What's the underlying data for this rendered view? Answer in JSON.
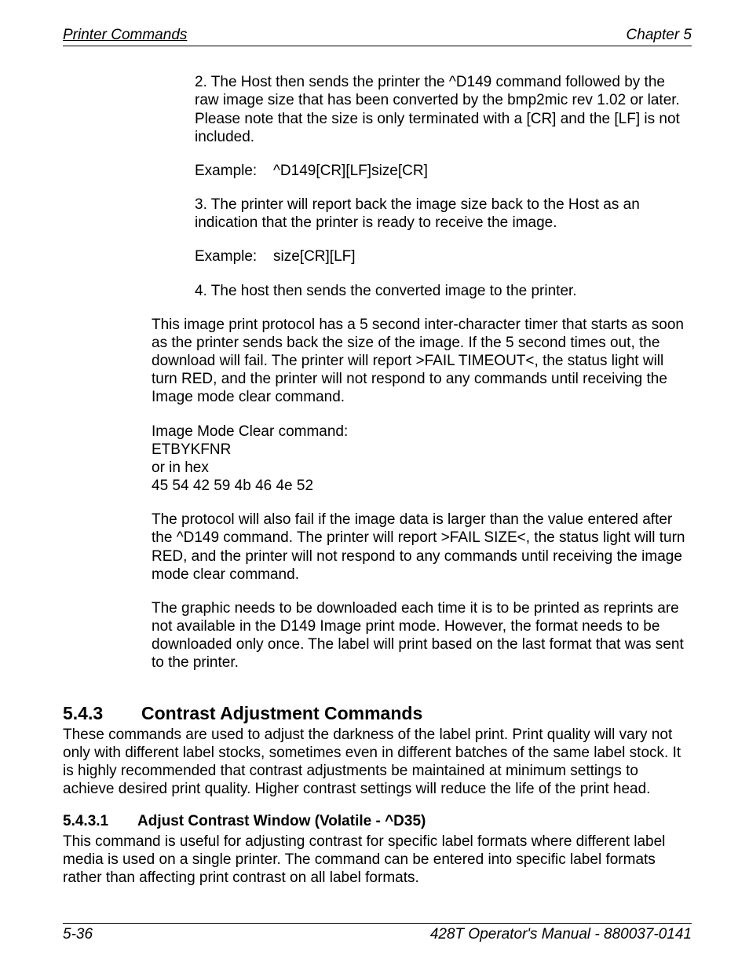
{
  "header": {
    "left": "Printer Commands",
    "right": "Chapter 5"
  },
  "body": {
    "p1": "2. The Host then sends the printer the ^D149 command followed by the raw image size that has been converted by the bmp2mic rev 1.02 or later.  Please note that the size is only terminated with a [CR] and the [LF] is not included.",
    "ex1_label": "Example:",
    "ex1_value": "^D149[CR][LF]size[CR]",
    "p2": "3. The printer will report back the image size back to the Host as an indication that the printer is ready to receive the image.",
    "ex2_label": "Example:",
    "ex2_value": "size[CR][LF]",
    "p3": "4. The host then sends the converted image to the printer.",
    "p4": "This image print protocol has a 5 second inter-character timer that starts as soon as the printer sends back the size of the image.  If the 5 second times out, the download will fail.  The printer will report >FAIL TIMEOUT<, the status light will turn RED, and the printer will not respond to any commands until receiving the Image mode clear command.",
    "p5a": "Image Mode Clear command:",
    "p5b": "ETBYKFNR",
    "p5c": "or in hex",
    "p5d": "45 54 42 59 4b 46 4e 52",
    "p6": "The protocol will also fail if the image data is larger than the value entered after the ^D149 command.  The printer will report >FAIL SIZE<, the status light will turn RED, and the printer will not respond to any commands until receiving the image mode clear command.",
    "p7": "The graphic needs to be downloaded each time it is to be printed as reprints are not available in the D149 Image print mode. However, the format needs to be downloaded only once. The label will print based on the last format that was sent to the printer."
  },
  "section": {
    "num": "5.4.3",
    "title": "Contrast Adjustment Commands",
    "text": "These commands are used to adjust the darkness of the label print.  Print quality will vary not only with different label stocks, sometimes even in different batches of the same label stock.  It is highly recommended that contrast adjustments be maintained at minimum settings to achieve desired print quality.  Higher contrast settings will reduce the life of the print head."
  },
  "subsection": {
    "num": "5.4.3.1",
    "title": "Adjust Contrast Window (Volatile - ^D35)",
    "text": "This command is useful for adjusting contrast for specific label formats where different label media is used on a single printer.  The command can be entered into specific label formats rather than affecting print contrast on all label formats."
  },
  "footer": {
    "left": "5-36",
    "right": "428T Operator's Manual - 880037-0141"
  }
}
